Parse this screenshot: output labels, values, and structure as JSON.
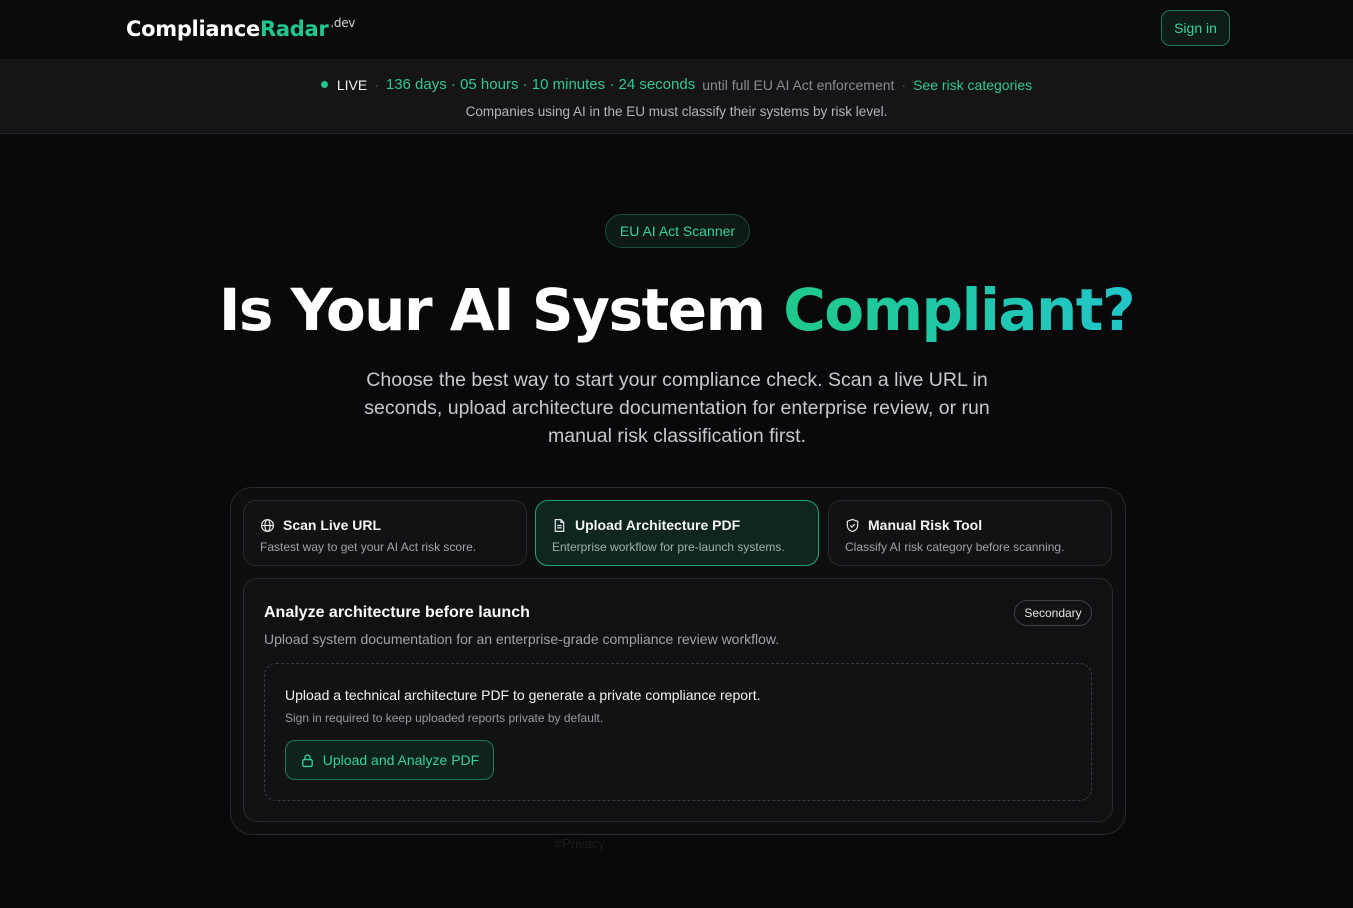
{
  "header": {
    "logo_part1": "Compliance",
    "logo_part2": "Radar",
    "logo_suffix": ".dev",
    "signin_label": "Sign in"
  },
  "banner": {
    "live_label": "LIVE",
    "countdown": "136 days · 05 hours · 10 minutes · 24 seconds",
    "enforcement_text": "until full EU AI Act enforcement",
    "risk_link": "See risk categories",
    "subtext": "Companies using AI in the EU must classify their systems by risk level."
  },
  "hero": {
    "badge": "EU AI Act Scanner",
    "headline_part1": "Is Your AI System ",
    "headline_part2": "Compliant?",
    "subtitle": "Choose the best way to start your compliance check. Scan a live URL in seconds, upload architecture documentation for enterprise review, or run manual risk classification first."
  },
  "tabs": [
    {
      "title": "Scan Live URL",
      "desc": "Fastest way to get your AI Act risk score.",
      "icon": "globe-icon",
      "active": false
    },
    {
      "title": "Upload Architecture PDF",
      "desc": "Enterprise workflow for pre-launch systems.",
      "icon": "document-icon",
      "active": true
    },
    {
      "title": "Manual Risk Tool",
      "desc": "Classify AI risk category before scanning.",
      "icon": "shield-icon",
      "active": false
    }
  ],
  "card": {
    "title": "Analyze architecture before launch",
    "subtitle": "Upload system documentation for an enterprise-grade compliance review workflow.",
    "badge": "Secondary",
    "dropzone_main": "Upload a technical architecture PDF to generate a private compliance report.",
    "dropzone_note": "Sign in required to keep uploaded reports private by default.",
    "upload_button": "Upload and Analyze PDF"
  },
  "footer_ghost": "#Privacy",
  "colors": {
    "accent": "#22c58b",
    "accent_alt": "#22c6c9",
    "background": "#09090b"
  }
}
